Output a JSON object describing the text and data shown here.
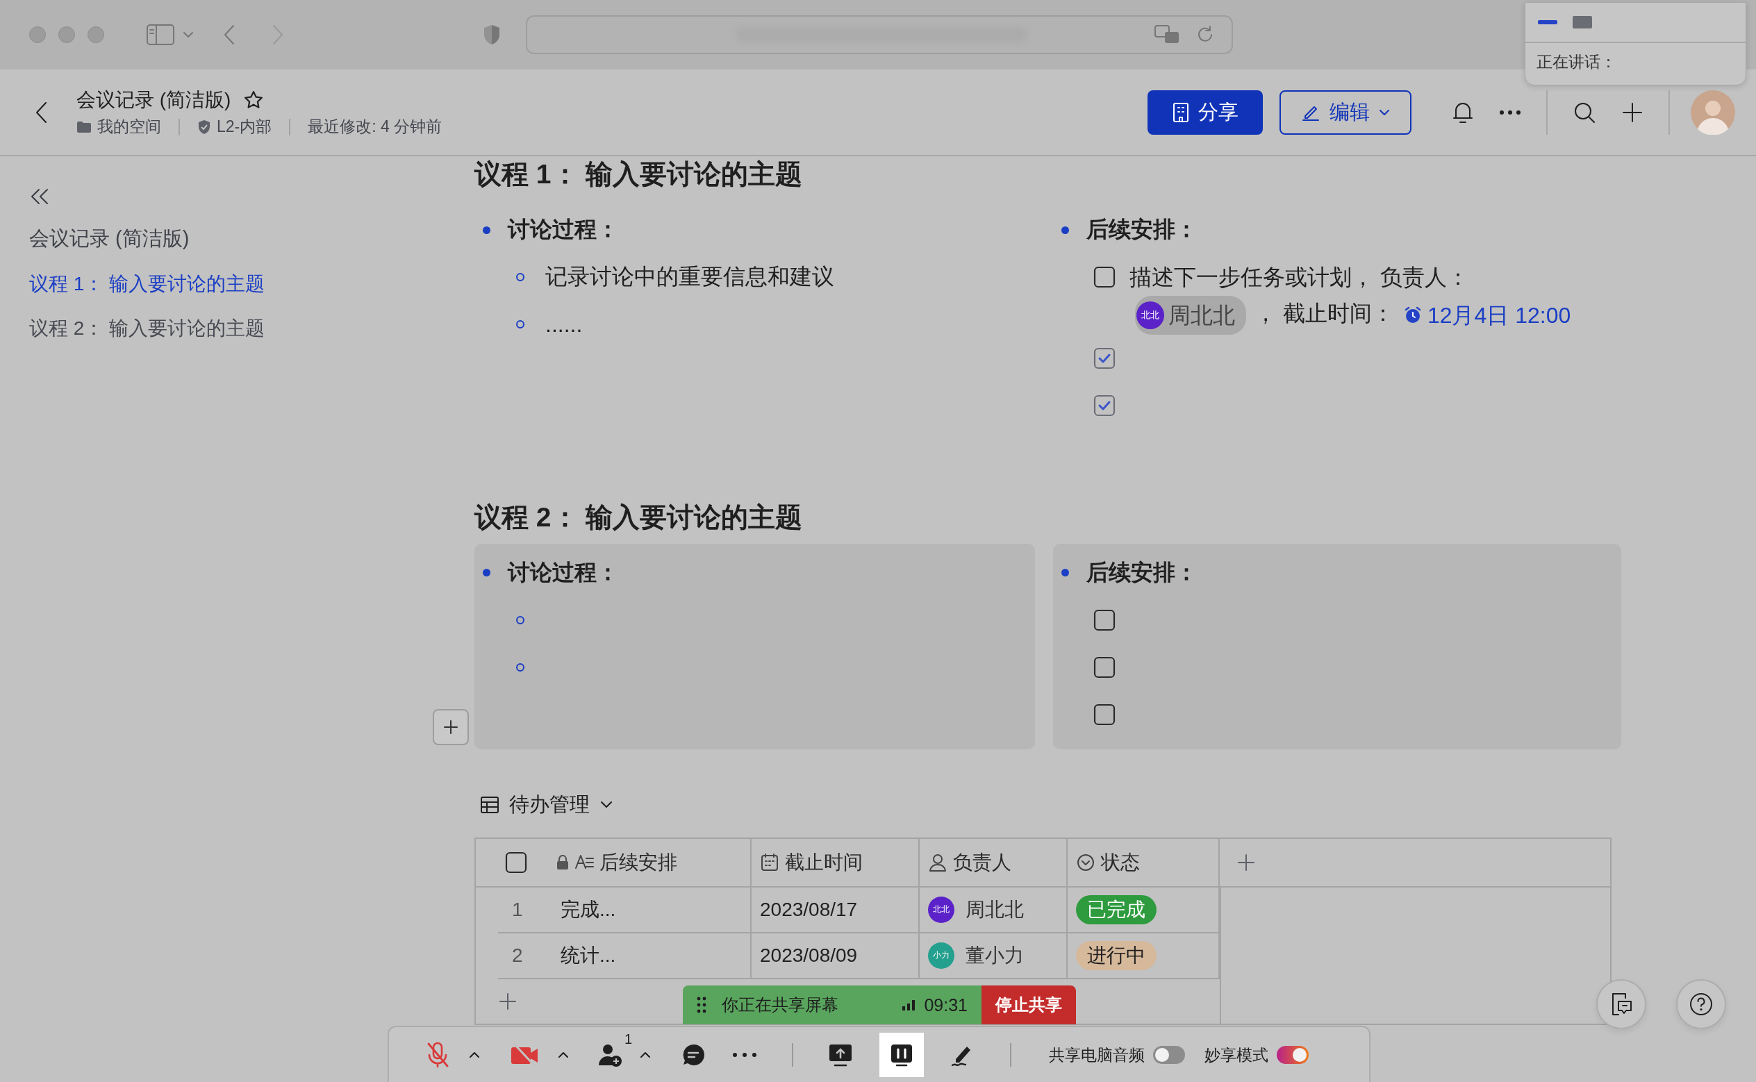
{
  "doc_header": {
    "title": "会议记录 (简洁版)",
    "starred": false,
    "meta": [
      {
        "kind": "folder",
        "text": "我的空间"
      },
      {
        "kind": "shield",
        "text": "L2-内部"
      },
      {
        "kind": "plain",
        "text": "最近修改: 4 分钟前"
      }
    ],
    "share_button": "分享",
    "edit_button": "编辑"
  },
  "speaking_panel": {
    "label": "正在讲话："
  },
  "sidebar": {
    "title": "会议记录 (简洁版)",
    "items": [
      {
        "label": "议程 1： 输入要讨论的主题",
        "selected": true
      },
      {
        "label": "议程 2： 输入要讨论的主题",
        "selected": false
      }
    ]
  },
  "sections": [
    {
      "heading": "议程 1： 输入要讨论的主题",
      "shaded": false,
      "add_handle": false,
      "discussion": {
        "label": "讨论过程：",
        "items": [
          {
            "kind": "text",
            "text": "记录讨论中的重要信息和建议"
          },
          {
            "kind": "text",
            "text": "......"
          }
        ]
      },
      "followup": {
        "label": "后续安排：",
        "tasks": [
          {
            "checked": false,
            "parts": [
              {
                "kind": "text",
                "text": "描述下一步任务或计划， 负责人："
              },
              {
                "kind": "mention",
                "avatar": "北北",
                "name": "周北北",
                "color": "#5a22c8"
              },
              {
                "kind": "text",
                "text": "， 截止时间："
              },
              {
                "kind": "date",
                "text": "12月4日 12:00"
              }
            ]
          },
          {
            "checked": true
          },
          {
            "checked": true
          }
        ]
      }
    },
    {
      "heading": "议程 2： 输入要讨论的主题",
      "shaded": true,
      "add_handle": true,
      "discussion": {
        "label": "讨论过程：",
        "items": [
          {
            "kind": "empty"
          },
          {
            "kind": "empty"
          }
        ]
      },
      "followup": {
        "label": "后续安排：",
        "tasks": [
          {
            "checked": false
          },
          {
            "checked": false
          },
          {
            "checked": false
          }
        ]
      }
    }
  ],
  "table": {
    "title": "待办管理",
    "select_all_checked": false,
    "columns": [
      {
        "kind": "text",
        "label": "后续安排",
        "locked": true
      },
      {
        "kind": "date",
        "label": "截止时间",
        "locked": false
      },
      {
        "kind": "person",
        "label": "负责人",
        "locked": false
      },
      {
        "kind": "status",
        "label": "状态",
        "locked": false
      }
    ],
    "rows": [
      {
        "index": "1",
        "task": "完成...",
        "due": "2023/08/17",
        "owner": {
          "avatar": "北北",
          "name": "周北北",
          "color": "#5a22c8"
        },
        "status": {
          "label": "已完成",
          "color": "#2e9b3e"
        }
      },
      {
        "index": "2",
        "task": "统计...",
        "due": "2023/08/09",
        "owner": {
          "avatar": "小力",
          "name": "董小力",
          "color": "#24a08e"
        },
        "status": {
          "label": "进行中",
          "color": "#d6b89a"
        }
      }
    ]
  },
  "share_banner": {
    "label": "你正在共享屏幕",
    "time": "09:31",
    "stop_button": "停止共享"
  },
  "toolbar": {
    "items": [
      {
        "kind": "mic",
        "off": true
      },
      {
        "kind": "caret"
      },
      {
        "kind": "camera",
        "off": true
      },
      {
        "kind": "caret"
      },
      {
        "kind": "participants",
        "count": "1"
      },
      {
        "kind": "caret"
      },
      {
        "kind": "chat"
      },
      {
        "kind": "more"
      },
      {
        "kind": "divider"
      },
      {
        "kind": "share"
      },
      {
        "kind": "pause",
        "active": true
      },
      {
        "kind": "annotate"
      },
      {
        "kind": "divider"
      },
      {
        "kind": "toggle",
        "label": "共享电脑音频",
        "on": false
      },
      {
        "kind": "toggle",
        "label": "妙享模式",
        "on": true
      }
    ]
  }
}
